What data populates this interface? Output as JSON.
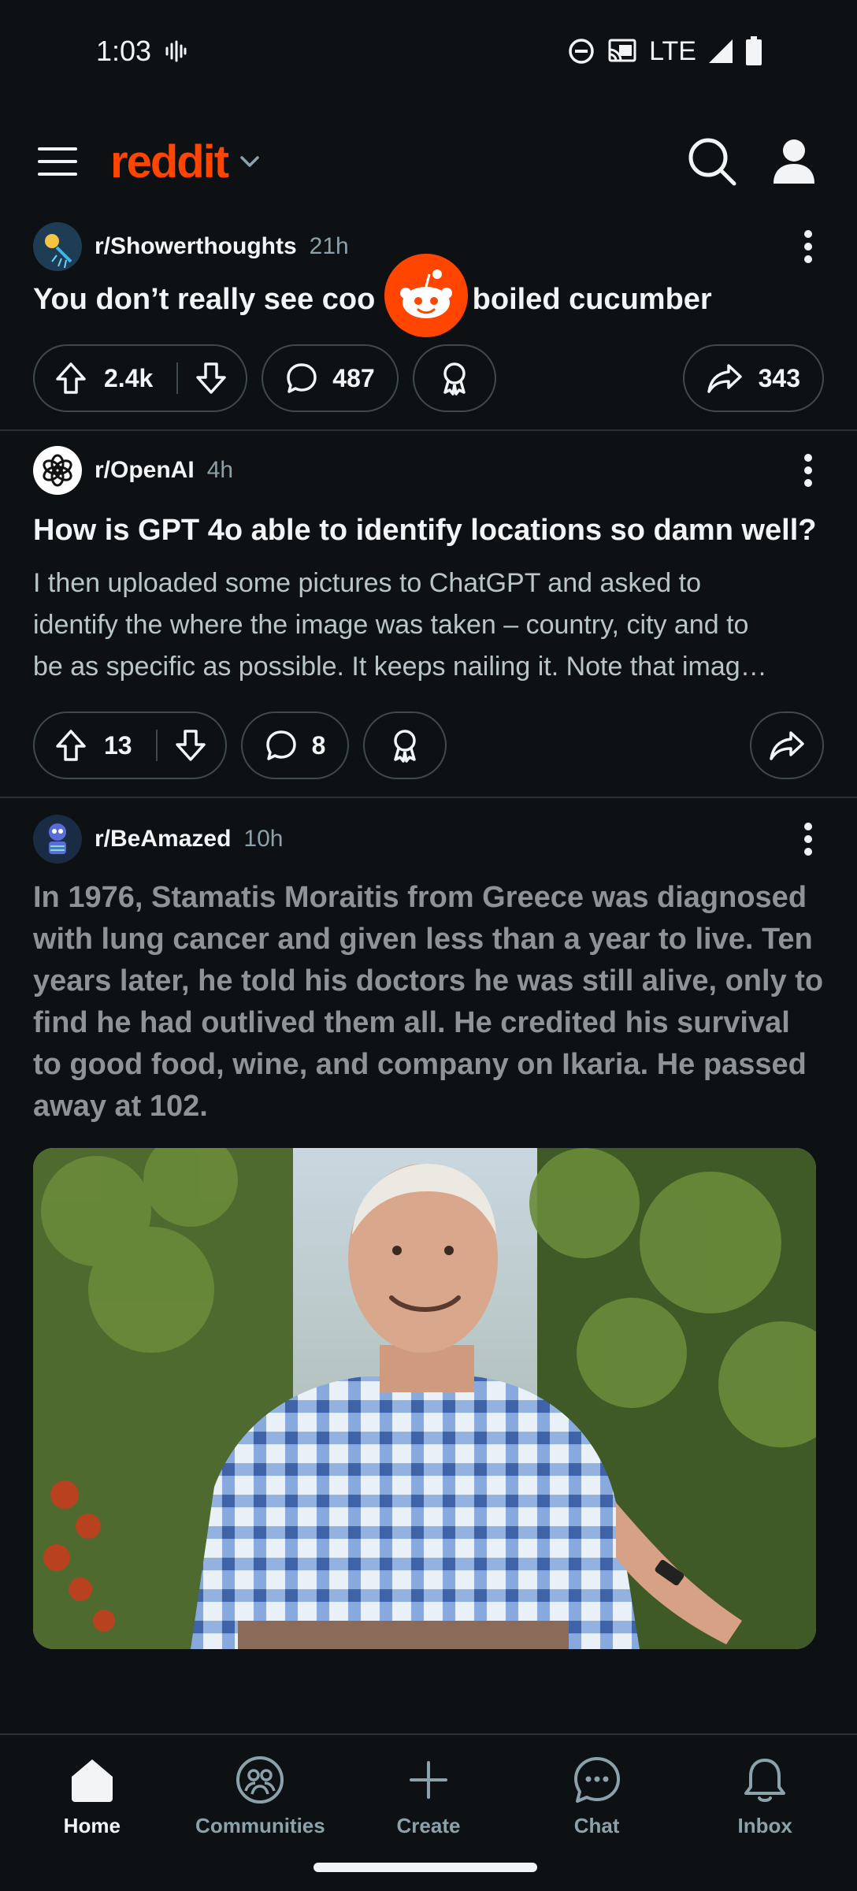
{
  "status_bar": {
    "time": "1:03",
    "network": "LTE"
  },
  "header": {
    "logo": "reddit",
    "menu_icon": "hamburger-menu-icon",
    "search_icon": "search-icon",
    "profile_icon": "user-profile-icon"
  },
  "colors": {
    "brand": "#ff4500",
    "background": "#0e1113",
    "text": "#f2f4f5",
    "muted": "#8ba2ad"
  },
  "posts": [
    {
      "subreddit": "r/Showerthoughts",
      "age": "21h",
      "title": "You don’t really see coo",
      "title_end": "r boiled cucumber",
      "upvotes": "2.4k",
      "comments": "487",
      "shares": "343"
    },
    {
      "subreddit": "r/OpenAI",
      "age": "4h",
      "title": "How is GPT 4o able to identify locations so damn well?",
      "body_lines": [
        "I then uploaded some pictures to ChatGPT and asked to",
        "identify the where the image was taken – country, city and to",
        "be as specific as possible. It keeps nailing it. Note that imag…"
      ],
      "upvotes": "13",
      "comments": "8"
    },
    {
      "subreddit": "r/BeAmazed",
      "age": "10h",
      "title": "In 1976, Stamatis Moraitis from Greece was diagnosed with lung cancer and given less than a year to live. Ten years later, he told his doctors he was still alive, only to find he had outlived them all. He credited his survival to good food, wine, and company on Ikaria. He passed away at 102."
    }
  ],
  "bottom_nav": [
    {
      "label": "Home",
      "icon": "home-icon"
    },
    {
      "label": "Communities",
      "icon": "communities-icon"
    },
    {
      "label": "Create",
      "icon": "plus-icon"
    },
    {
      "label": "Chat",
      "icon": "chat-icon"
    },
    {
      "label": "Inbox",
      "icon": "bell-icon"
    }
  ]
}
